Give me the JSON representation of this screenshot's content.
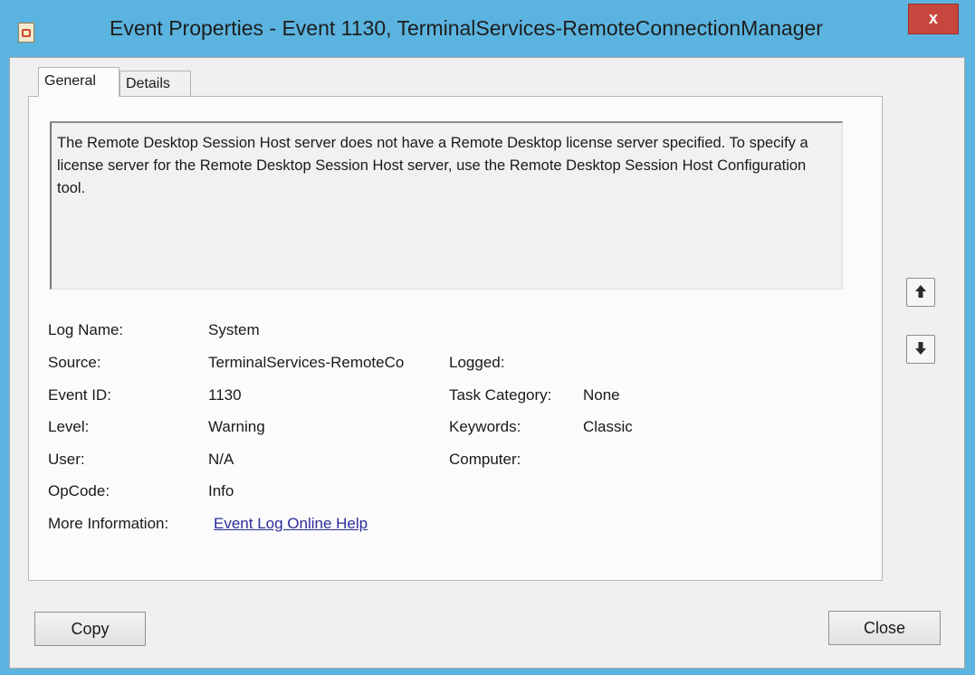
{
  "window": {
    "title": "Event Properties - Event 1130, TerminalServices-RemoteConnectionManager",
    "close_glyph": "x"
  },
  "tabs": [
    {
      "label": "General",
      "selected": true
    },
    {
      "label": "Details",
      "selected": false
    }
  ],
  "general": {
    "description": "The Remote Desktop Session Host server does not have a Remote Desktop license server specified. To specify a license server for the Remote Desktop Session Host server, use the Remote Desktop Session Host Configuration tool.",
    "log_name": {
      "label": "Log Name:",
      "value": "System"
    },
    "source": {
      "label": "Source:",
      "value": "TerminalServices-RemoteCo"
    },
    "logged": {
      "label": "Logged:",
      "value": ""
    },
    "event_id": {
      "label": "Event ID:",
      "value": "1130"
    },
    "task_category": {
      "label": "Task Category:",
      "value": "None"
    },
    "level": {
      "label": "Level:",
      "value": "Warning"
    },
    "keywords": {
      "label": "Keywords:",
      "value": "Classic"
    },
    "user": {
      "label": "User:",
      "value": "N/A"
    },
    "computer": {
      "label": "Computer:",
      "value": ""
    },
    "opcode": {
      "label": "OpCode:",
      "value": "Info"
    },
    "more_info": {
      "label": "More Information:",
      "link": "Event Log Online Help"
    }
  },
  "nav": {
    "up_icon": "arrow-up-icon",
    "down_icon": "arrow-down-icon"
  },
  "buttons": {
    "copy": "Copy",
    "close": "Close"
  },
  "colors": {
    "frame": "#5bb4df",
    "close_button": "#c7463d",
    "link": "#2c2c9c"
  }
}
